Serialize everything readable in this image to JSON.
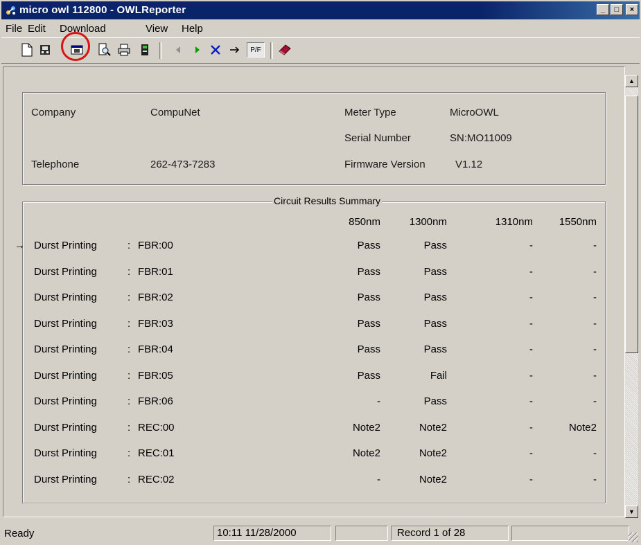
{
  "window": {
    "title": "micro owl 112800 - OWLReporter",
    "minimize": "_",
    "maximize": "□",
    "close": "×"
  },
  "menu": [
    {
      "label": "File"
    },
    {
      "label": "Edit"
    },
    {
      "label": "Download"
    },
    {
      "label": "View"
    },
    {
      "label": "Help"
    }
  ],
  "toolbar": {
    "icons": [
      "new-document-icon",
      "download-meter-icon",
      "download-report-icon",
      "print-preview-icon",
      "print-icon",
      "meter-icon",
      "previous-icon",
      "next-icon",
      "delete-icon",
      "goto-icon",
      "pass-fail-icon",
      "book-icon"
    ],
    "pf_label": "P/F",
    "highlight_color": "#d81414"
  },
  "info": {
    "company_label": "Company",
    "company_value": "CompuNet",
    "telephone_label": "Telephone",
    "telephone_value": "262-473-7283",
    "meter_type_label": "Meter Type",
    "meter_type_value": "MicroOWL",
    "serial_label": "Serial Number",
    "serial_value": "SN:MO11009",
    "firmware_label": "Firmware Version",
    "firmware_value": "V1.12"
  },
  "summary": {
    "title": "Circuit Results Summary",
    "columns": [
      "850nm",
      "1300nm",
      "1310nm",
      "1550nm"
    ],
    "current_marker": "→",
    "rows": [
      {
        "name": "Durst Printing",
        "sep": ":",
        "circuit": "FBR:00",
        "values": [
          "Pass",
          "Pass",
          "-",
          "-"
        ]
      },
      {
        "name": "Durst Printing",
        "sep": ":",
        "circuit": "FBR:01",
        "values": [
          "Pass",
          "Pass",
          "-",
          "-"
        ]
      },
      {
        "name": "Durst Printing",
        "sep": ":",
        "circuit": "FBR:02",
        "values": [
          "Pass",
          "Pass",
          "-",
          "-"
        ]
      },
      {
        "name": "Durst Printing",
        "sep": ":",
        "circuit": "FBR:03",
        "values": [
          "Pass",
          "Pass",
          "-",
          "-"
        ]
      },
      {
        "name": "Durst Printing",
        "sep": ":",
        "circuit": "FBR:04",
        "values": [
          "Pass",
          "Pass",
          "-",
          "-"
        ]
      },
      {
        "name": "Durst Printing",
        "sep": ":",
        "circuit": "FBR:05",
        "values": [
          "Pass",
          "Fail",
          "-",
          "-"
        ]
      },
      {
        "name": "Durst Printing",
        "sep": ":",
        "circuit": "FBR:06",
        "values": [
          "-",
          "Pass",
          "-",
          "-"
        ]
      },
      {
        "name": "Durst Printing",
        "sep": ":",
        "circuit": "REC:00",
        "values": [
          "Note2",
          "Note2",
          "-",
          "Note2"
        ]
      },
      {
        "name": "Durst Printing",
        "sep": ":",
        "circuit": "REC:01",
        "values": [
          "Note2",
          "Note2",
          "-",
          "-"
        ]
      },
      {
        "name": "Durst Printing",
        "sep": ":",
        "circuit": "REC:02",
        "values": [
          "-",
          "Note2",
          "-",
          "-"
        ]
      }
    ]
  },
  "status": {
    "state": "Ready",
    "datetime": "10:11  11/28/2000",
    "record": "Record 1 of 28"
  }
}
